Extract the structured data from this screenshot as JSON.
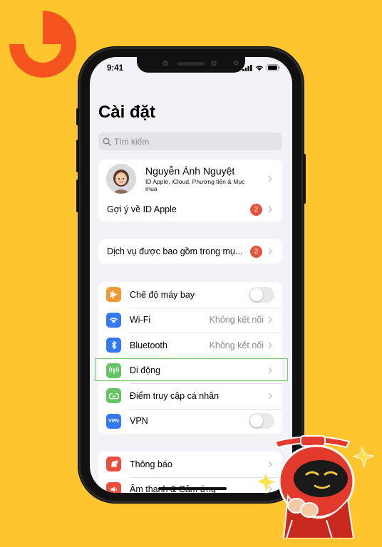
{
  "status_bar": {
    "time": "9:41"
  },
  "title": "Cài đặt",
  "search": {
    "placeholder": "Tìm kiếm"
  },
  "profile": {
    "name": "Nguyễn Ánh Nguyệt",
    "subtitle": "ID Apple, iCloud, Phương tiện & Mục mua",
    "suggest_label": "Gợi ý về ID Apple",
    "suggest_badge": "2"
  },
  "services": {
    "label": "Dịch vụ được bao gồm trong mụ...",
    "badge": "2"
  },
  "connectivity": [
    {
      "label": "Chế độ máy bay",
      "icon": "airplane-icon",
      "color": "#F09A37",
      "control": "toggle"
    },
    {
      "label": "Wi-Fi",
      "icon": "wifi-icon",
      "color": "#3478F6",
      "value": "Không kết nối"
    },
    {
      "label": "Bluetooth",
      "icon": "bluetooth-icon",
      "color": "#3478F6",
      "value": "Không kết nối"
    },
    {
      "label": "Di động",
      "icon": "cellular-icon",
      "color": "#65C466"
    },
    {
      "label": "Điểm truy cập cá nhân",
      "icon": "hotspot-icon",
      "color": "#65C466"
    },
    {
      "label": "VPN",
      "icon": "vpn-icon",
      "color": "#3478F6",
      "control": "toggle",
      "icon_text": "VPN"
    }
  ],
  "notifications": [
    {
      "label": "Thông báo",
      "icon": "bell-icon",
      "color": "#EB4E3D"
    },
    {
      "label": "Âm thanh & Cảm ứng",
      "icon": "sound-icon",
      "color": "#EB4E3D"
    }
  ],
  "colors": {
    "background": "#FEC52E",
    "accent": "#3478F6",
    "badge": "#E5533C",
    "highlight": "#7BC96F"
  }
}
